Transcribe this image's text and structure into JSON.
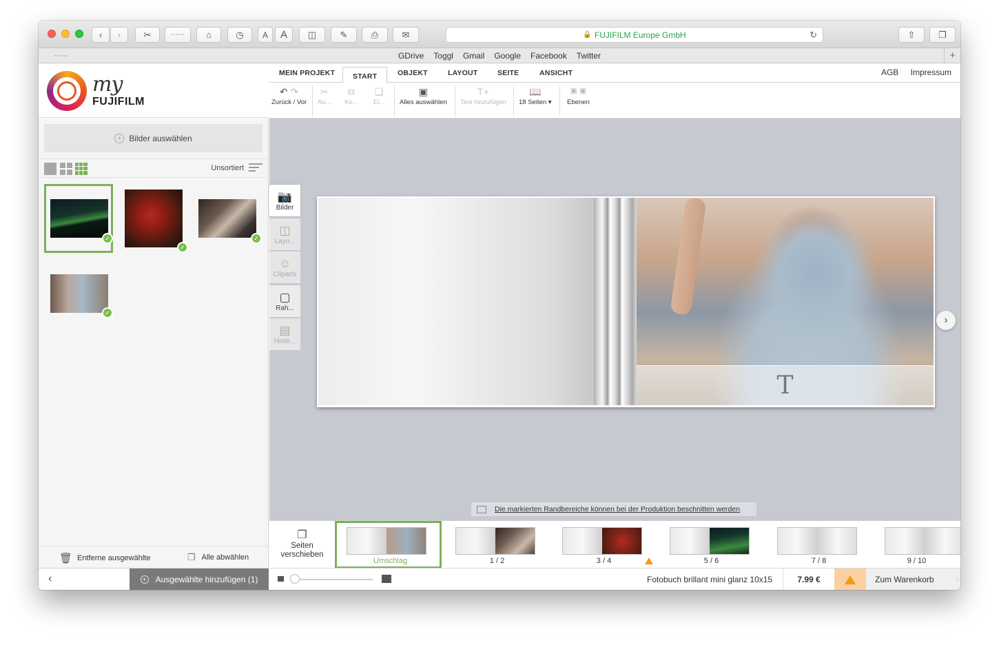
{
  "browser": {
    "address": "FUJIFILM Europe GmbH",
    "bookmarks": [
      "GDrive",
      "Toggl",
      "Gmail",
      "Google",
      "Facebook",
      "Twitter"
    ],
    "text_small": "A",
    "text_large": "A"
  },
  "logo": {
    "script": "my",
    "brand": "FUJIFILM"
  },
  "menu": {
    "tabs": [
      "MEIN PROJEKT",
      "START",
      "OBJEKT",
      "LAYOUT",
      "SEITE",
      "ANSICHT"
    ],
    "active_tab": "START",
    "links": [
      "AGB",
      "Impressum"
    ]
  },
  "ribbon": {
    "undo_redo": "Zurück / Vor",
    "cut": "Au...",
    "copy": "Ko...",
    "paste": "Ei...",
    "select_all": "Alles auswählen",
    "add_text": "Text hinzufügen",
    "pages": "18 Seiten ▾",
    "layers": "Ebenen"
  },
  "left_panel": {
    "pick_images": "Bilder auswählen",
    "sort_label": "Unsortiert",
    "remove_selected": "Entferne ausgewählte",
    "deselect_all": "Alle abwählen",
    "add_selected": "Ausgewählte hinzufügen (1)"
  },
  "tools": [
    "Bilder",
    "Layo...",
    "Cliparts",
    "Rah...",
    "Hinte..."
  ],
  "canvas": {
    "text_placeholder": "T",
    "notice": "Die markierten Randbereiche können bei der Produktion beschnitten werden"
  },
  "pages_strip": {
    "move_label_1": "Seiten",
    "move_label_2": "verschieben",
    "pages": [
      {
        "label": "Umschlag",
        "selected": true
      },
      {
        "label": "1 / 2",
        "selected": false
      },
      {
        "label": "3 / 4",
        "selected": false,
        "warning": true
      },
      {
        "label": "5 / 6",
        "selected": false
      },
      {
        "label": "7 / 8",
        "selected": false
      },
      {
        "label": "9 / 10",
        "selected": false
      }
    ]
  },
  "status": {
    "product": "Fotobuch brillant mini glanz 10x15",
    "price": "7.99 €",
    "cart": "Zum Warenkorb"
  },
  "colors": {
    "accent_green": "#7cb05a",
    "address_green": "#2aa34a",
    "warning_orange": "#f39c12",
    "canvas_bg": "#c7c9d1"
  }
}
